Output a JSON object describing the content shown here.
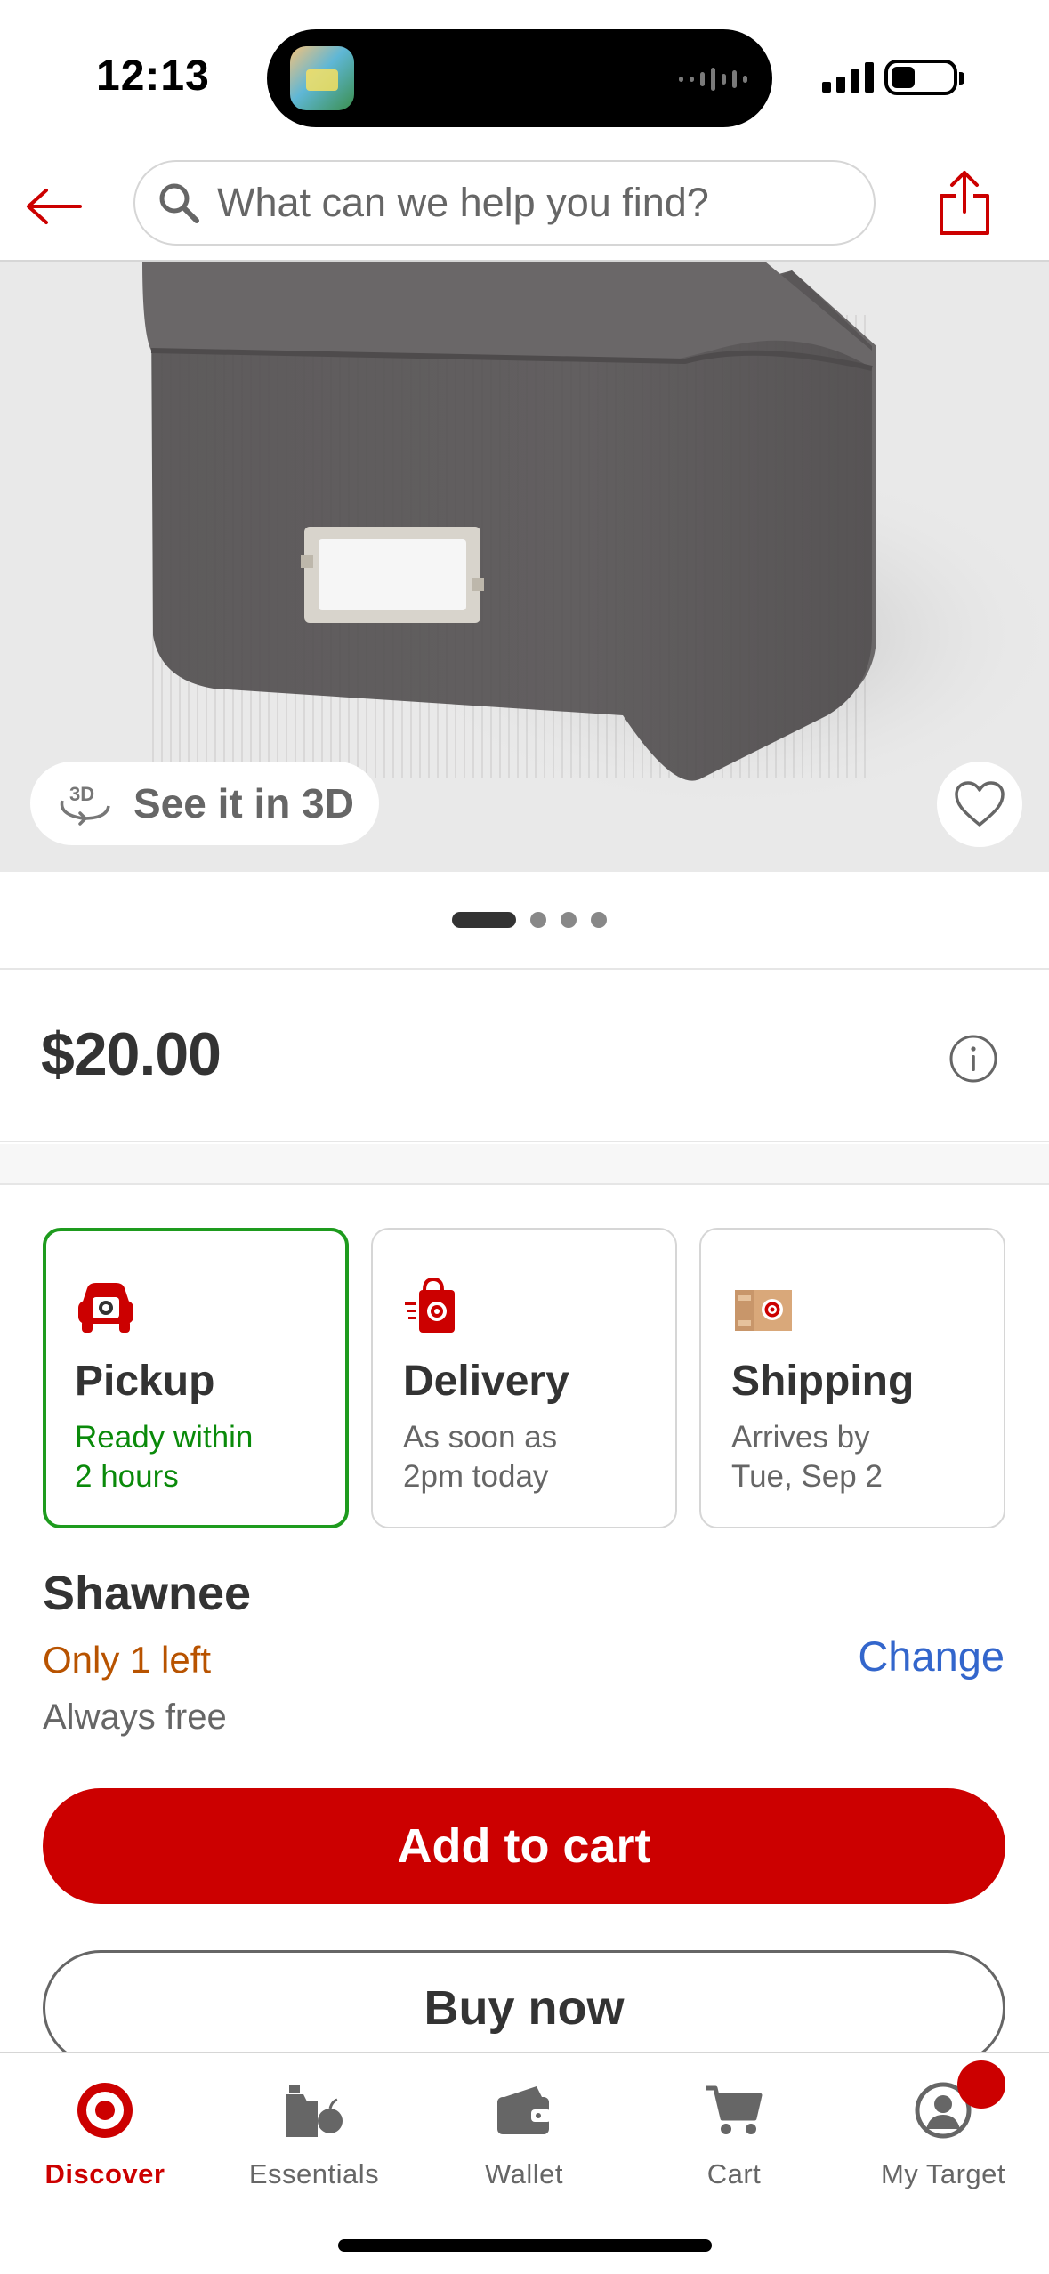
{
  "status_bar": {
    "time": "12:13"
  },
  "header": {
    "search_placeholder": "What can we help you find?"
  },
  "product_image": {
    "see_3d_label": "See it in 3D",
    "see_3d_icon_text": "3D",
    "carousel": {
      "total": 4,
      "active_index": 0
    }
  },
  "price": {
    "value": "$20.00"
  },
  "fulfillment": {
    "selected": "pickup",
    "options": [
      {
        "id": "pickup",
        "title": "Pickup",
        "subtitle": "Ready within\n2 hours"
      },
      {
        "id": "delivery",
        "title": "Delivery",
        "subtitle": "As soon as\n2pm today"
      },
      {
        "id": "shipping",
        "title": "Shipping",
        "subtitle": "Arrives by\nTue, Sep 2"
      }
    ]
  },
  "store": {
    "name": "Shawnee",
    "stock": "Only 1 left",
    "change_label": "Change",
    "free_text": "Always free"
  },
  "actions": {
    "add_to_cart": "Add to cart",
    "buy_now": "Buy now"
  },
  "tab_bar": {
    "active": "discover",
    "tabs": [
      {
        "id": "discover",
        "label": "Discover",
        "icon": "target-bullseye-icon"
      },
      {
        "id": "essentials",
        "label": "Essentials",
        "icon": "essentials-icon"
      },
      {
        "id": "wallet",
        "label": "Wallet",
        "icon": "wallet-icon"
      },
      {
        "id": "cart",
        "label": "Cart",
        "icon": "cart-icon"
      },
      {
        "id": "my-target",
        "label": "My Target",
        "icon": "account-icon"
      }
    ]
  },
  "colors": {
    "brand_red": "#cc0000",
    "selected_green": "#1e9b1e",
    "link_blue": "#3366cc",
    "stock_orange": "#b85300"
  }
}
